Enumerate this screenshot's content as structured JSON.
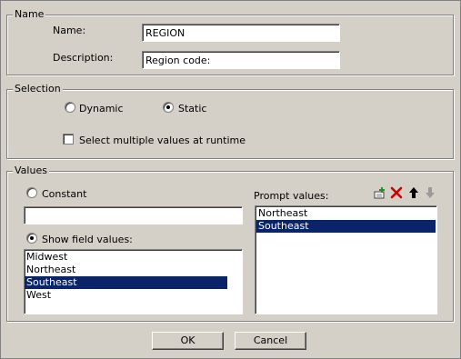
{
  "name_group": {
    "legend": "Name",
    "name_label": "Name:",
    "name_value": "REGION",
    "description_label": "Description:",
    "description_value": "Region code:"
  },
  "selection_group": {
    "legend": "Selection",
    "dynamic_label": "Dynamic",
    "static_label": "Static",
    "multi_label": "Select multiple values at runtime",
    "selected": "Static",
    "multi_checked": false
  },
  "values_group": {
    "legend": "Values",
    "constant_label": "Constant",
    "constant_value": "",
    "show_field_label": "Show field values:",
    "selected_mode": "Show field values",
    "field_values": [
      "Midwest",
      "Northeast",
      "Southeast",
      "West"
    ],
    "field_selected": "Southeast",
    "prompt_label": "Prompt values:",
    "prompt_values": [
      "Northeast",
      "Southeast"
    ],
    "prompt_selected": "Southeast",
    "toolbar_icons": [
      "add-icon",
      "delete-icon",
      "move-up-icon",
      "move-down-icon"
    ]
  },
  "buttons": {
    "ok": "OK",
    "cancel": "Cancel"
  },
  "colors": {
    "selection": "#0a246a",
    "dialog_bg": "#d4d0c8",
    "delete": "#cc0000"
  }
}
